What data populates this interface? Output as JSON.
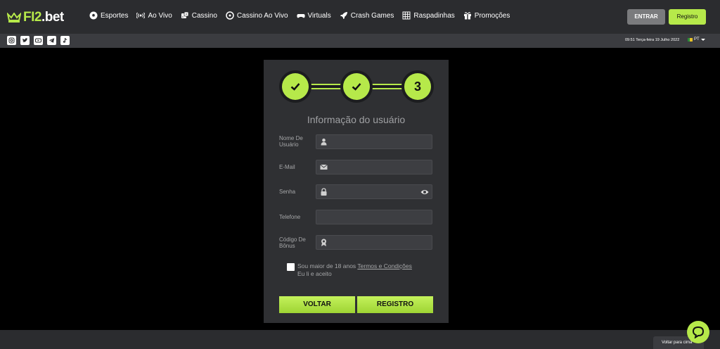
{
  "header": {
    "logo_f12": "FI2",
    "logo_bet": ".bet",
    "nav": [
      {
        "label": "Esportes",
        "icon": "soccer-ball-icon"
      },
      {
        "label": "Ao Vivo",
        "icon": "broadcast-icon"
      },
      {
        "label": "Cassino",
        "icon": "dice-icon"
      },
      {
        "label": "Cassino Ao Vivo",
        "icon": "roulette-icon"
      },
      {
        "label": "Virtuals",
        "icon": "gamepad-icon"
      },
      {
        "label": "Crash Games",
        "icon": "rocket-icon"
      },
      {
        "label": "Raspadinhas",
        "icon": "grid-icon"
      },
      {
        "label": "Promoções",
        "icon": "gift-icon"
      }
    ],
    "login_label": "ENTRAR",
    "register_label": "Registro"
  },
  "subbar": {
    "social": [
      "instagram-icon",
      "twitter-icon",
      "youtube-icon",
      "telegram-icon",
      "tiktok-icon"
    ],
    "datetime": "09:51 Terça-feira 19 Julho 2022",
    "language": "PT"
  },
  "form": {
    "steps": [
      "✓",
      "✓",
      "3"
    ],
    "title": "Informação do usuário",
    "fields": [
      {
        "label": "Nome De Usuário",
        "icon": "user-icon",
        "value": ""
      },
      {
        "label": "E-Mail",
        "icon": "envelope-icon",
        "value": ""
      },
      {
        "label": "Senha",
        "icon": "lock-icon",
        "value": ""
      },
      {
        "label": "Telefone",
        "icon": "",
        "value": ""
      },
      {
        "label": "Código De Bônus",
        "icon": "badge-icon",
        "value": ""
      }
    ],
    "age_text": "Sou maior de 18 anos",
    "terms_link": "Termos e Condições",
    "accept_text": "Eu li e aceito",
    "back_label": "VOLTAR",
    "submit_label": "REGISTRO"
  },
  "footer": {
    "back_to_top": "Voltar para cima"
  },
  "colors": {
    "accent": "#b6e94a",
    "header_bg": "#2b2c2f",
    "panel_bg": "#2f3033"
  }
}
